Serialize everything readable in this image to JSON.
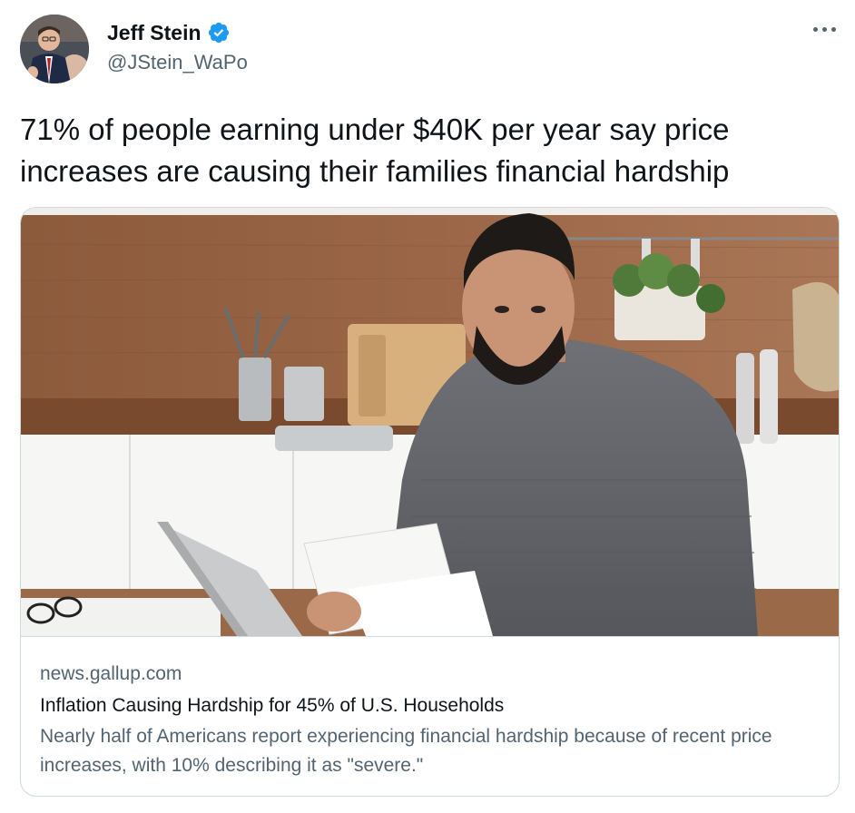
{
  "author": {
    "display_name": "Jeff Stein",
    "handle": "@JStein_WaPo",
    "verified": true,
    "avatar": "avatar-photo"
  },
  "more_icon": "more-horizontal-icon",
  "tweet": {
    "text": "71% of people earning under $40K per year say price increases are causing their families financial hardship"
  },
  "link_card": {
    "image": "man-reviewing-bill-in-kitchen-photo",
    "domain": "news.gallup.com",
    "title": "Inflation Causing Hardship for 45% of U.S. Households",
    "description": "Nearly half of Americans report experiencing financial hardship because of recent price increases, with 10% describing it as \"severe.\""
  },
  "colors": {
    "verified_badge": "#1d9bf0",
    "secondary_text": "#536471",
    "primary_text": "#0f1419",
    "border": "#cfd9de"
  }
}
